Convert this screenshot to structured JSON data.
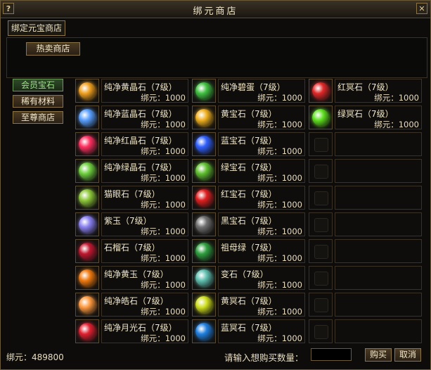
{
  "window": {
    "title": "绑元商店",
    "help_glyph": "?",
    "close_glyph": "✕"
  },
  "tabs": [
    {
      "label": "绑定元宝商店"
    }
  ],
  "hot_button": "热卖商店",
  "categories": [
    {
      "label": "会员宝石",
      "selected": true
    },
    {
      "label": "稀有材料",
      "selected": false
    },
    {
      "label": "至尊商店",
      "selected": false
    }
  ],
  "price_prefix": "绑元：",
  "columns": [
    [
      {
        "name": "纯净黄晶石（7级）",
        "price": "1000",
        "icon": "yellow-crystal-icon",
        "color": "#f0a020"
      },
      {
        "name": "纯净蓝晶石（7级）",
        "price": "1000",
        "icon": "blue-crystal-icon",
        "color": "#5aa0ff"
      },
      {
        "name": "纯净红晶石（7级）",
        "price": "1000",
        "icon": "red-crystal-icon",
        "color": "#ff3060"
      },
      {
        "name": "纯净绿晶石（7级）",
        "price": "1000",
        "icon": "green-crystal-icon",
        "color": "#70d040"
      },
      {
        "name": "猫眼石（7级）",
        "price": "1000",
        "icon": "cats-eye-icon",
        "color": "#8ec83a"
      },
      {
        "name": "紫玉（7级）",
        "price": "1000",
        "icon": "purple-jade-icon",
        "color": "#8a80f0"
      },
      {
        "name": "石榴石（7级）",
        "price": "1000",
        "icon": "garnet-icon",
        "color": "#c01830"
      },
      {
        "name": "纯净黄玉（7级）",
        "price": "1000",
        "icon": "topaz-icon",
        "color": "#f07a10"
      },
      {
        "name": "纯净皓石（7级）",
        "price": "1000",
        "icon": "white-gem-icon",
        "color": "#ff9a40"
      },
      {
        "name": "纯净月光石（7级）",
        "price": "1000",
        "icon": "moonstone-icon",
        "color": "#e02030"
      }
    ],
    [
      {
        "name": "纯净碧蛋（7级）",
        "price": "1000",
        "icon": "jade-egg-icon",
        "color": "#40c040"
      },
      {
        "name": "黄宝石（7级）",
        "price": "1000",
        "icon": "yellow-gem-icon",
        "color": "#f0b020"
      },
      {
        "name": "蓝宝石（7级）",
        "price": "1000",
        "icon": "sapphire-icon",
        "color": "#3060ff"
      },
      {
        "name": "绿宝石（7级）",
        "price": "1000",
        "icon": "emerald-icon",
        "color": "#60c030"
      },
      {
        "name": "红宝石（7级）",
        "price": "1000",
        "icon": "ruby-icon",
        "color": "#e02020"
      },
      {
        "name": "黑宝石（7级）",
        "price": "1000",
        "icon": "black-gem-icon",
        "color": "#707070"
      },
      {
        "name": "祖母绿（7级）",
        "price": "1000",
        "icon": "malachite-icon",
        "color": "#30a040"
      },
      {
        "name": "变石（7级）",
        "price": "1000",
        "icon": "alexandrite-icon",
        "color": "#60c0b0"
      },
      {
        "name": "黄冥石（7级）",
        "price": "1000",
        "icon": "yellow-dark-stone-icon",
        "color": "#d0e020"
      },
      {
        "name": "蓝冥石（7级）",
        "price": "1000",
        "icon": "blue-dark-stone-icon",
        "color": "#2080e0"
      }
    ],
    [
      {
        "name": "红冥石（7级）",
        "price": "1000",
        "icon": "red-dark-stone-icon",
        "color": "#e02828"
      },
      {
        "name": "绿冥石（7级）",
        "price": "1000",
        "icon": "green-dark-stone-icon",
        "color": "#60e020"
      }
    ]
  ],
  "footer": {
    "balance_label": "绑元：489800",
    "quantity_label": "请输入想购买数量：",
    "quantity_value": "",
    "buy_label": "购买",
    "cancel_label": "取消"
  }
}
